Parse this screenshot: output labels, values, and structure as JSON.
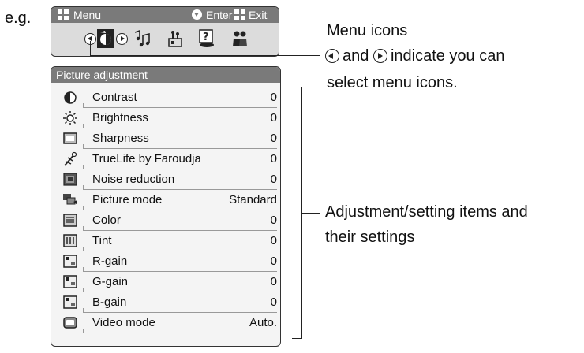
{
  "example_label": "e.g.",
  "menu": {
    "title": "Menu",
    "enter_label": "Enter",
    "exit_label": "Exit",
    "icons": [
      "picture-icon",
      "audio-icon",
      "setup-icon",
      "help-icon",
      "users-icon"
    ]
  },
  "picture_adjustment": {
    "title": "Picture adjustment",
    "items": [
      {
        "label": "Contrast",
        "value": "0",
        "icon": "contrast-icon"
      },
      {
        "label": "Brightness",
        "value": "0",
        "icon": "brightness-icon"
      },
      {
        "label": "Sharpness",
        "value": "0",
        "icon": "sharpness-icon"
      },
      {
        "label": "TrueLife by Faroudja",
        "value": "0",
        "icon": "truelife-icon"
      },
      {
        "label": "Noise reduction",
        "value": "0",
        "icon": "noise-reduction-icon"
      },
      {
        "label": "Picture mode",
        "value": "Standard",
        "icon": "picture-mode-icon"
      },
      {
        "label": "Color",
        "value": "0",
        "icon": "color-icon"
      },
      {
        "label": "Tint",
        "value": "0",
        "icon": "tint-icon"
      },
      {
        "label": "R-gain",
        "value": "0",
        "icon": "r-gain-icon"
      },
      {
        "label": "G-gain",
        "value": "0",
        "icon": "g-gain-icon"
      },
      {
        "label": "B-gain",
        "value": "0",
        "icon": "b-gain-icon"
      },
      {
        "label": "Video mode",
        "value": "Auto.",
        "icon": "video-mode-icon"
      }
    ]
  },
  "annotations": {
    "menu_icons": "Menu icons",
    "arrows_text_1": "and",
    "arrows_text_2": "indicate you can",
    "arrows_text_3": "select menu icons.",
    "items_text_1": "Adjustment/setting items and",
    "items_text_2": "their settings"
  }
}
